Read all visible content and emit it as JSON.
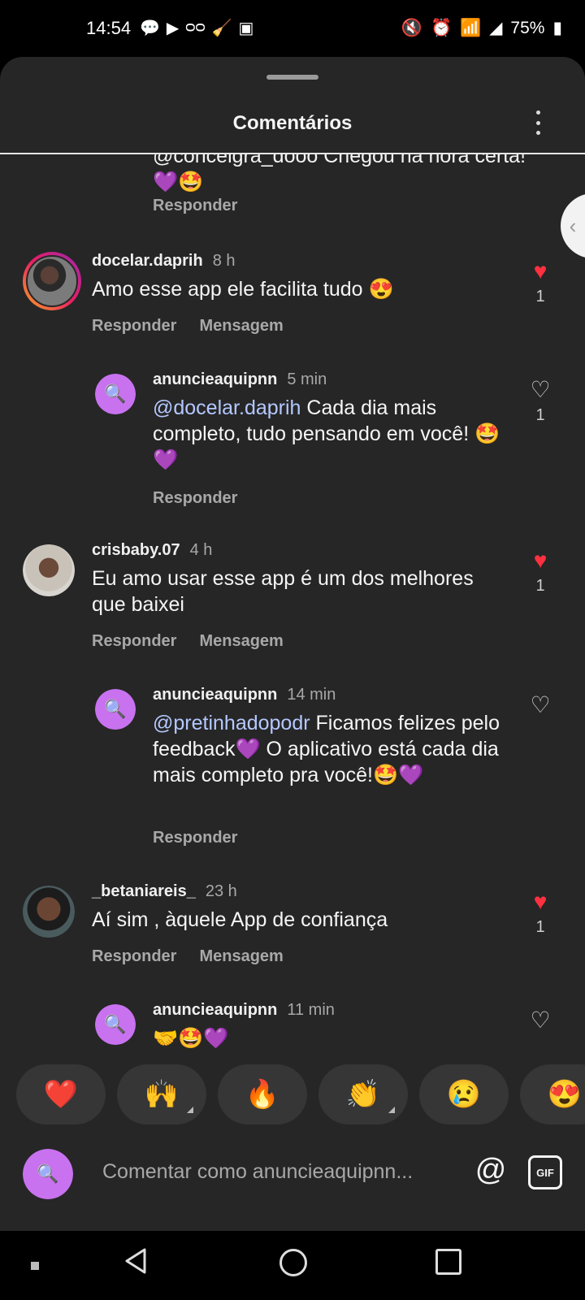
{
  "status_bar": {
    "time": "14:54",
    "left_icons": [
      "chat-icon",
      "youtube-icon",
      "voicemail-icon",
      "broom-icon",
      "sim-icon"
    ],
    "right_icons": [
      "mute-icon",
      "alarm-icon",
      "wifi-icon",
      "signal-icon"
    ],
    "battery_percent": "75%"
  },
  "sheet": {
    "title": "Comentários"
  },
  "truncated_comment": {
    "text_partial": "@conceigra_dooo Chegou na hora certa!💜🤩",
    "reply_label": "Responder"
  },
  "comments": [
    {
      "username": "docelar.daprih",
      "time": "8 h",
      "text": "Amo esse app ele facilita tudo 😍",
      "actions": [
        "Responder",
        "Mensagem"
      ],
      "liked": true,
      "like_count": "1",
      "replies": [
        {
          "username": "anuncieaquipnn",
          "time": "5 min",
          "mention": "@docelar.daprih",
          "text": " Cada dia mais completo, tudo pensando em você! 🤩💜",
          "reply_label": "Responder",
          "liked": false,
          "like_count": "1"
        }
      ]
    },
    {
      "username": "crisbaby.07",
      "time": "4 h",
      "text": "Eu amo usar esse app é um dos melhores que baixei",
      "actions": [
        "Responder",
        "Mensagem"
      ],
      "liked": true,
      "like_count": "1",
      "replies": [
        {
          "username": "anuncieaquipnn",
          "time": "14 min",
          "mention": "@pretinhadopodr",
          "text": " Ficamos felizes pelo feedback💜 O aplicativo está cada dia mais completo pra você!🤩💜",
          "reply_label": "Responder",
          "liked": false,
          "like_count": ""
        }
      ]
    },
    {
      "username": "_betaniareis_",
      "time": "23 h",
      "text": "Aí sim , àquele App de confiança",
      "actions": [
        "Responder",
        "Mensagem"
      ],
      "liked": true,
      "like_count": "1",
      "replies": [
        {
          "username": "anuncieaquipnn",
          "time": "11 min",
          "mention": "",
          "text": "🤝🤩💜",
          "reply_label": "",
          "liked": false,
          "like_count": ""
        }
      ]
    }
  ],
  "reactions": [
    "❤️",
    "🙌",
    "🔥",
    "👏",
    "😢",
    "😍"
  ],
  "composer": {
    "placeholder": "Comentar como anuncieaquipnn...",
    "at_label": "@",
    "gif_label": "GIF"
  },
  "colors": {
    "sheet_bg": "#262626",
    "like_red": "#ff3040",
    "mention_blue": "#b4c8ff",
    "brand_purple": "#c872f0"
  }
}
